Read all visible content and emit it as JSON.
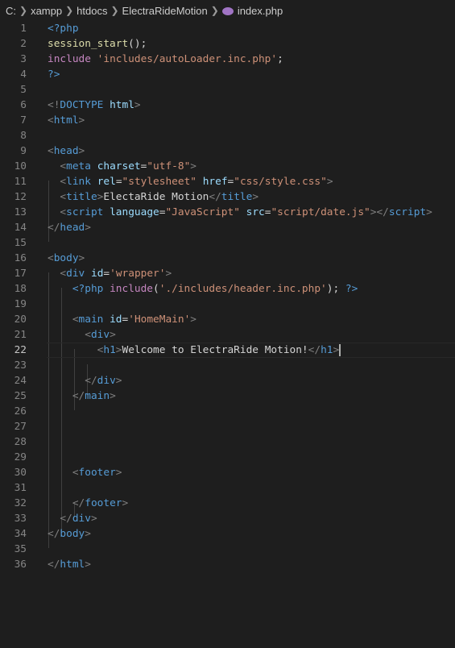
{
  "breadcrumb": {
    "items": [
      "C:",
      "xampp",
      "htdocs",
      "ElectraRideMotion"
    ],
    "file": "index.php",
    "file_icon": "php-elephant-icon"
  },
  "editor": {
    "active_line": 22,
    "colors": {
      "tag": "#569cd6",
      "attribute": "#9cdcfe",
      "string": "#ce9178",
      "keyword": "#c586c0",
      "function": "#dcdcaa",
      "text": "#d4d4d4"
    },
    "lines": [
      {
        "n": "1",
        "tokens": [
          [
            "php",
            "<?php"
          ]
        ]
      },
      {
        "n": "2",
        "tokens": [
          [
            "fn",
            "session_start"
          ],
          [
            "punc",
            "();"
          ]
        ]
      },
      {
        "n": "3",
        "tokens": [
          [
            "kw",
            "include"
          ],
          [
            "text",
            " "
          ],
          [
            "str",
            "'includes/autoLoader.inc.php'"
          ],
          [
            "punc",
            ";"
          ]
        ]
      },
      {
        "n": "4",
        "tokens": [
          [
            "php",
            "?>"
          ]
        ]
      },
      {
        "n": "5",
        "tokens": []
      },
      {
        "n": "6",
        "tokens": [
          [
            "br",
            "<!"
          ],
          [
            "tag",
            "DOCTYPE"
          ],
          [
            "text",
            " "
          ],
          [
            "attr",
            "html"
          ],
          [
            "br",
            ">"
          ]
        ]
      },
      {
        "n": "7",
        "tokens": [
          [
            "br",
            "<"
          ],
          [
            "tag",
            "html"
          ],
          [
            "br",
            ">"
          ]
        ]
      },
      {
        "n": "8",
        "tokens": []
      },
      {
        "n": "9",
        "tokens": [
          [
            "br",
            "<"
          ],
          [
            "tag",
            "head"
          ],
          [
            "br",
            ">"
          ]
        ]
      },
      {
        "n": "10",
        "tokens": [
          [
            "text",
            "  "
          ],
          [
            "br",
            "<"
          ],
          [
            "tag",
            "meta"
          ],
          [
            "text",
            " "
          ],
          [
            "attr",
            "charset"
          ],
          [
            "text",
            "="
          ],
          [
            "str",
            "\"utf-8\""
          ],
          [
            "br",
            ">"
          ]
        ]
      },
      {
        "n": "11",
        "tokens": [
          [
            "text",
            "  "
          ],
          [
            "br",
            "<"
          ],
          [
            "tag",
            "link"
          ],
          [
            "text",
            " "
          ],
          [
            "attr",
            "rel"
          ],
          [
            "text",
            "="
          ],
          [
            "str",
            "\"stylesheet\""
          ],
          [
            "text",
            " "
          ],
          [
            "attr",
            "href"
          ],
          [
            "text",
            "="
          ],
          [
            "str",
            "\"css/style.css\""
          ],
          [
            "br",
            ">"
          ]
        ]
      },
      {
        "n": "12",
        "tokens": [
          [
            "text",
            "  "
          ],
          [
            "br",
            "<"
          ],
          [
            "tag",
            "title"
          ],
          [
            "br",
            ">"
          ],
          [
            "text",
            "ElectaRide Motion"
          ],
          [
            "br",
            "</"
          ],
          [
            "tag",
            "title"
          ],
          [
            "br",
            ">"
          ]
        ]
      },
      {
        "n": "13",
        "tokens": [
          [
            "text",
            "  "
          ],
          [
            "br",
            "<"
          ],
          [
            "tag",
            "script"
          ],
          [
            "text",
            " "
          ],
          [
            "attr",
            "language"
          ],
          [
            "text",
            "="
          ],
          [
            "str",
            "\"JavaScript\""
          ],
          [
            "text",
            " "
          ],
          [
            "attr",
            "src"
          ],
          [
            "text",
            "="
          ],
          [
            "str",
            "\"script/date.js\""
          ],
          [
            "br",
            "></"
          ],
          [
            "tag",
            "script"
          ],
          [
            "br",
            ">"
          ]
        ]
      },
      {
        "n": "14",
        "tokens": [
          [
            "br",
            "</"
          ],
          [
            "tag",
            "head"
          ],
          [
            "br",
            ">"
          ]
        ]
      },
      {
        "n": "15",
        "tokens": []
      },
      {
        "n": "16",
        "tokens": [
          [
            "br",
            "<"
          ],
          [
            "tag",
            "body"
          ],
          [
            "br",
            ">"
          ]
        ]
      },
      {
        "n": "17",
        "tokens": [
          [
            "text",
            "  "
          ],
          [
            "br",
            "<"
          ],
          [
            "tag",
            "div"
          ],
          [
            "text",
            " "
          ],
          [
            "attr",
            "id"
          ],
          [
            "text",
            "="
          ],
          [
            "str",
            "'wrapper'"
          ],
          [
            "br",
            ">"
          ]
        ]
      },
      {
        "n": "18",
        "tokens": [
          [
            "text",
            "    "
          ],
          [
            "php",
            "<?php"
          ],
          [
            "text",
            " "
          ],
          [
            "kw",
            "include"
          ],
          [
            "punc",
            "("
          ],
          [
            "str",
            "'./includes/header.inc.php'"
          ],
          [
            "punc",
            ");"
          ],
          [
            "text",
            " "
          ],
          [
            "php",
            "?>"
          ]
        ]
      },
      {
        "n": "19",
        "tokens": []
      },
      {
        "n": "20",
        "tokens": [
          [
            "text",
            "    "
          ],
          [
            "br",
            "<"
          ],
          [
            "tag",
            "main"
          ],
          [
            "text",
            " "
          ],
          [
            "attr",
            "id"
          ],
          [
            "text",
            "="
          ],
          [
            "str",
            "'HomeMain'"
          ],
          [
            "br",
            ">"
          ]
        ]
      },
      {
        "n": "21",
        "tokens": [
          [
            "text",
            "      "
          ],
          [
            "br",
            "<"
          ],
          [
            "tag",
            "div"
          ],
          [
            "br",
            ">"
          ]
        ]
      },
      {
        "n": "22",
        "tokens": [
          [
            "text",
            "        "
          ],
          [
            "br",
            "<"
          ],
          [
            "tag",
            "h1"
          ],
          [
            "br",
            ">"
          ],
          [
            "text",
            "Welcome to ElectraRide Motion!"
          ],
          [
            "br",
            "</"
          ],
          [
            "tag",
            "h1"
          ],
          [
            "br",
            ">"
          ]
        ],
        "cursor": true
      },
      {
        "n": "23",
        "tokens": []
      },
      {
        "n": "24",
        "tokens": [
          [
            "text",
            "      "
          ],
          [
            "br",
            "</"
          ],
          [
            "tag",
            "div"
          ],
          [
            "br",
            ">"
          ]
        ]
      },
      {
        "n": "25",
        "tokens": [
          [
            "text",
            "    "
          ],
          [
            "br",
            "</"
          ],
          [
            "tag",
            "main"
          ],
          [
            "br",
            ">"
          ]
        ]
      },
      {
        "n": "26",
        "tokens": []
      },
      {
        "n": "27",
        "tokens": []
      },
      {
        "n": "28",
        "tokens": []
      },
      {
        "n": "29",
        "tokens": []
      },
      {
        "n": "30",
        "tokens": [
          [
            "text",
            "    "
          ],
          [
            "br",
            "<"
          ],
          [
            "tag",
            "footer"
          ],
          [
            "br",
            ">"
          ]
        ]
      },
      {
        "n": "31",
        "tokens": []
      },
      {
        "n": "32",
        "tokens": [
          [
            "text",
            "    "
          ],
          [
            "br",
            "</"
          ],
          [
            "tag",
            "footer"
          ],
          [
            "br",
            ">"
          ]
        ]
      },
      {
        "n": "33",
        "tokens": [
          [
            "text",
            "  "
          ],
          [
            "br",
            "</"
          ],
          [
            "tag",
            "div"
          ],
          [
            "br",
            ">"
          ]
        ]
      },
      {
        "n": "34",
        "tokens": [
          [
            "br",
            "</"
          ],
          [
            "tag",
            "body"
          ],
          [
            "br",
            ">"
          ]
        ]
      },
      {
        "n": "35",
        "tokens": []
      },
      {
        "n": "36",
        "tokens": [
          [
            "br",
            "</"
          ],
          [
            "tag",
            "html"
          ],
          [
            "br",
            ">"
          ]
        ]
      }
    ]
  }
}
